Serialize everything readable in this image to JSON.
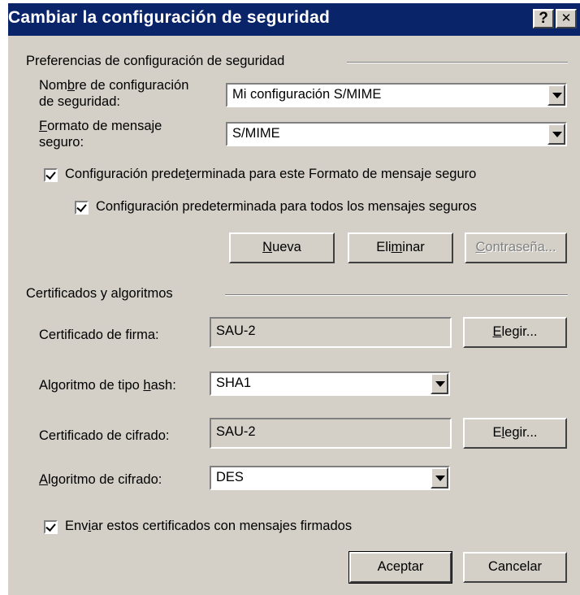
{
  "window": {
    "title": "Cambiar la configuración de seguridad",
    "help_button": "?",
    "close_button": "✕"
  },
  "prefs": {
    "group_label": "Preferencias de configuración de seguridad",
    "name_label_a": "Nom",
    "name_label_u": "b",
    "name_label_b": "re de configuración",
    "name_label_line2": "de seguridad:",
    "name_value": "Mi configuración S/MIME",
    "format_label_u": "F",
    "format_label_a": "ormato de mensaje",
    "format_label_line2": "seguro:",
    "format_value": "S/MIME",
    "default_format_a": "Configuración prede",
    "default_format_u": "t",
    "default_format_b": "erminada para este Formato de mensaje seguro",
    "default_all_a": "Confi",
    "default_all_u": "g",
    "default_all_b": "uración predeterminada para todos los mensajes seguros",
    "new_u": "N",
    "new_b": "ueva",
    "delete_a": "Eli",
    "delete_u": "m",
    "delete_b": "inar",
    "password_u": "C",
    "password_b": "ontraseña..."
  },
  "certs": {
    "group_label": "Certificados y algoritmos",
    "sign_label": "Certificado de firma:",
    "sign_value": "SAU-2",
    "choose1_u": "E",
    "choose1_b": "legir...",
    "hash_label_a": "Algoritmo de tipo ",
    "hash_label_u": "h",
    "hash_label_b": "ash:",
    "hash_value": "SHA1",
    "enc_label": "Certificado de cifrado:",
    "enc_value": "SAU-2",
    "choose2_a": "E",
    "choose2_u": "l",
    "choose2_b": "egir...",
    "alg_label_u": "A",
    "alg_label_b": "lgoritmo de cifrado:",
    "alg_value": "DES",
    "send_a": "Env",
    "send_u": "i",
    "send_b": "ar estos certificados con mensajes firmados"
  },
  "footer": {
    "ok": "Aceptar",
    "cancel": "Cancelar"
  }
}
